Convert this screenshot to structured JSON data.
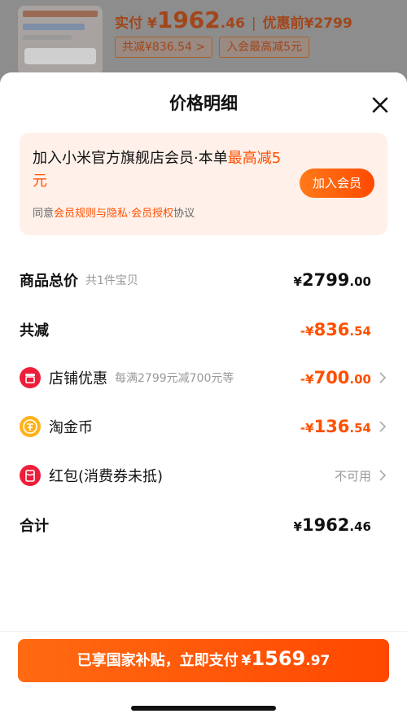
{
  "product_header": {
    "paid_label": "实付",
    "paid_symbol": "¥",
    "paid_int": "1962",
    "paid_dec": ".46",
    "separator": "|",
    "original_label": "优惠前¥2799",
    "chip_discount": "共减¥836.54 >",
    "chip_member": "入会最高减5元"
  },
  "sheet": {
    "title": "价格明细",
    "close_icon": "close-icon"
  },
  "member_banner": {
    "text_prefix": "加入小米官方旗舰店会员·本单",
    "text_highlight": "最高减5元",
    "agree_prefix": "同意",
    "agree_link": "会员规则与隐私·会员授权",
    "agree_suffix": "协议",
    "join_button": "加入会员"
  },
  "rows": {
    "total": {
      "label": "商品总价",
      "sub": "共1件宝贝",
      "symbol": "¥",
      "int": "2799",
      "dec": ".00"
    },
    "reduce": {
      "label": "共减",
      "symbol": "-¥",
      "int": "836",
      "dec": ".54"
    },
    "shop": {
      "label": "店铺优惠",
      "sub": "每满2799元减700元等",
      "symbol": "-¥",
      "int": "700",
      "dec": ".00",
      "icon": "shop-icon"
    },
    "coin": {
      "label": "淘金币",
      "symbol": "-¥",
      "int": "136",
      "dec": ".54",
      "icon": "coin-icon"
    },
    "redpacket": {
      "label": "红包(消费券未抵)",
      "value": "不可用",
      "icon": "red-packet-icon"
    },
    "sum": {
      "label": "合计",
      "symbol": "¥",
      "int": "1962",
      "dec": ".46"
    }
  },
  "pay_button": {
    "text": "已享国家补贴，立即支付",
    "symbol": "¥",
    "int": "1569",
    "dec": ".97"
  },
  "colors": {
    "accent": "#ff5000",
    "banner_bg": "#fff1ea",
    "shop_icon": "#ee1d3a",
    "coin_icon": "#ffb21a"
  }
}
